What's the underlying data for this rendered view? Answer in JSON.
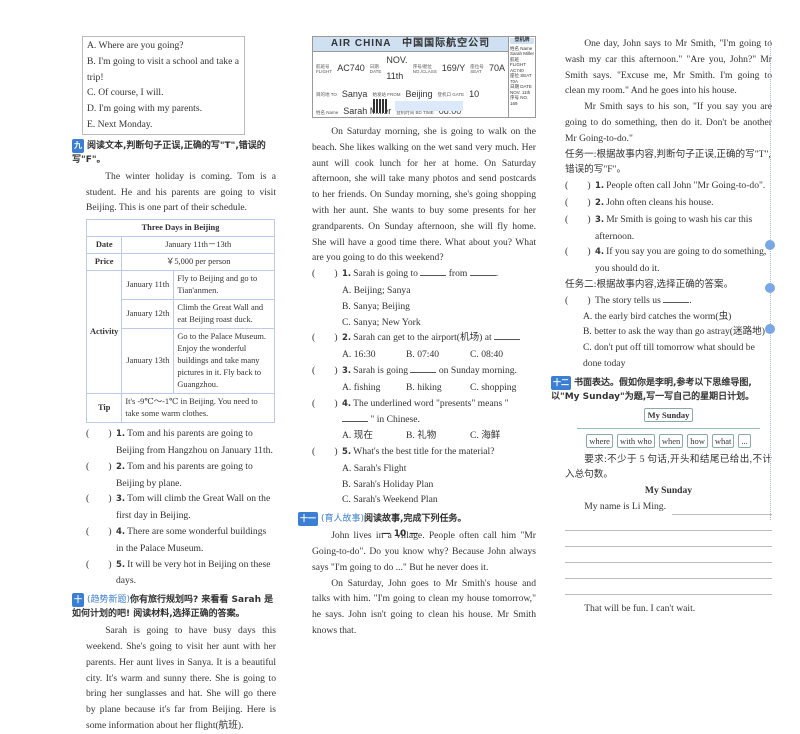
{
  "left": {
    "options": [
      "A. Where are you going?",
      "B. I'm going to visit a school and take a trip!",
      "C. Of course, I will.",
      "D. I'm going with my parents.",
      "E. Next Monday."
    ],
    "sec9": {
      "badge": "九",
      "title": "阅读文本,判断句子正误,正确的写\"T\",错误的写\"F\"。"
    },
    "sec9_text": "The winter holiday is coming. Tom is a student. He and his parents are going to visit Beijing. This is one part of their schedule.",
    "table": {
      "title": "Three Days in Beijing",
      "date_label": "Date",
      "date": "January 11th－13th",
      "price_label": "Price",
      "price": "￥5,000 per person",
      "activity_label": "Activity",
      "activities": [
        {
          "day": "January 11th",
          "text": "Fly to Beijing and go to Tian'anmen."
        },
        {
          "day": "January 12th",
          "text": "Climb the Great Wall and eat Beijing roast duck."
        },
        {
          "day": "January 13th",
          "text": "Go to the Palace Museum. Enjoy the wonderful buildings and take many pictures in it. Fly back to Guangzhou."
        }
      ],
      "tip_label": "Tip",
      "tip": "It's -9℃～-1℃ in Beijing. You need to take some warm clothes."
    },
    "questions": [
      {
        "n": "1.",
        "t": "Tom and his parents are going to Beijing from Hangzhou on January 11th."
      },
      {
        "n": "2.",
        "t": "Tom and his parents are going to Beijing by plane."
      },
      {
        "n": "3.",
        "t": "Tom will climb the Great Wall on the first day in Beijing."
      },
      {
        "n": "4.",
        "t": "There are some wonderful buildings in the Palace Museum."
      },
      {
        "n": "5.",
        "t": "It will be very hot in Beijing on these days."
      }
    ],
    "sec10": {
      "badge": "十",
      "tag": "(趋势新题)",
      "title": "你有旅行规划吗? 来看看 Sarah 是如何计划的吧! 阅读材料,选择正确的答案。"
    },
    "sec10_text": "Sarah is going to have busy days this weekend. She's going to visit her aunt with her parents. Her aunt lives in Sanya. It is a beautiful city. It's warm and sunny there. She is going to bring her sunglasses and hat. She will go there by plane because it's far from Beijing. Here is some information about her flight(航班)."
  },
  "boarding_pass": {
    "airline": "AIR CHINA　中国国际航空公司",
    "flight_label": "航班号 FLIGHT",
    "flight": "AC740",
    "date_label": "日期 DATE",
    "date": "NOV. 11th",
    "no_label": "序号/舱位 NO./CLASS",
    "no": "169/Y",
    "seat_label": "座位号 SEAT",
    "seat": "70A",
    "to_label": "目的地 TO",
    "to": "Sanya",
    "from_label": "始发站 FROM",
    "from": "Beijing",
    "gate_label": "登机口 GATE",
    "gate": "10",
    "name_label": "姓名 Name",
    "name": "Sarah Miller",
    "time_label": "登机时间 BD TIME",
    "time": "08:00",
    "stub_title": "登机牌",
    "stub": [
      "姓名 Name Sarah Miller",
      "航班 FLIGHT AC740",
      "座位 SEAT 70A",
      "日期 DATE NOV. 11th",
      "序号 NO. 169"
    ]
  },
  "mid": {
    "text": "On Saturday morning, she is going to walk on the beach. She likes walking on the wet sand very much. Her aunt will cook lunch for her at home. On Saturday afternoon, she will take many photos and send postcards to her friends. On Sunday morning, she's going shopping with her aunt. She wants to buy some presents for her grandparents. On Sunday afternoon, she will fly home. She will have a good time there. What about you? What are you going to do this weekend?",
    "questions": [
      {
        "n": "1.",
        "a": "Sarah is going to",
        "b": "from",
        "c": ".",
        "opts": [
          "A. Beijing; Sanya",
          "B. Sanya; Beijing",
          "C. Sanya; New York"
        ]
      },
      {
        "n": "2.",
        "a": "Sarah can get to the airport(机场) at",
        "opts": [
          "A. 16:30",
          "B. 07:40",
          "C. 08:40"
        ]
      },
      {
        "n": "3.",
        "a": "Sarah is going",
        "b": "on Sunday morning.",
        "opts": [
          "A. fishing",
          "B. hiking",
          "C. shopping"
        ]
      },
      {
        "n": "4.",
        "a": "The underlined word \"presents\" means \"",
        "b": "\" in Chinese.",
        "opts": [
          "A. 现在",
          "B. 礼物",
          "C. 海鲜"
        ]
      },
      {
        "n": "5.",
        "a": "What's the best title for the material?",
        "opts": [
          "A. Sarah's Flight",
          "B. Sarah's Holiday Plan",
          "C. Sarah's Weekend Plan"
        ]
      }
    ],
    "sec11": {
      "badge": "十一",
      "tag": "(育人故事)",
      "title": "阅读故事,完成下列任务。"
    },
    "p1": "John lives in a village. People often call him \"Mr Going-to-do\". Do you know why? Because John always says \"I'm going to do ...\" But he never does it.",
    "p2": "On Saturday, John goes to Mr Smith's house and talks with him. \"I'm going to clean my house tomorrow,\" he says. John isn't going to clean his house. Mr Smith knows that."
  },
  "right": {
    "p3": "One day, John says to Mr Smith, \"I'm going to wash my car this afternoon.\" \"Are you, John?\" Mr Smith says. \"Excuse me, Mr Smith. I'm going to clean my room.\" And he goes into his house.",
    "p4": "Mr Smith says to his son, \"If you say you are going to do something, then do it. Don't be another Mr Going-to-do.\"",
    "task1": "任务一:根据故事内容,判断句子正误,正确的写\"T\",错误的写\"F\"。",
    "task1_q": [
      {
        "n": "1.",
        "t": "People often call John \"Mr Going-to-do\"."
      },
      {
        "n": "2.",
        "t": "John often cleans his house."
      },
      {
        "n": "3.",
        "t": "Mr Smith is going to wash his car this afternoon."
      },
      {
        "n": "4.",
        "t": "If you say you are going to do something, you should do it."
      }
    ],
    "task2": "任务二:根据故事内容,选择正确的答案。",
    "task2_q": "The story tells us",
    "task2_opts": [
      "A. the early bird catches the worm(虫)",
      "B. better to ask the way than go astray(迷路地)",
      "C. don't put off till tomorrow what should be done today"
    ],
    "sec12": {
      "badge": "十二",
      "title": "书面表达。假如你是李明,参考以下思维导图,以\"My Sunday\"为题,写一写自己的星期日计划。"
    },
    "mindmap": {
      "root": "My Sunday",
      "children": [
        "where",
        "with who",
        "when",
        "how",
        "what",
        "..."
      ]
    },
    "req": "要求:不少于 5 句话,开头和结尾已给出,不计入总句数。",
    "essay_title": "My Sunday",
    "essay_start": "My name is Li Ming.",
    "essay_end": "That will be fun. I can't wait."
  },
  "page_number": "— 10 —"
}
